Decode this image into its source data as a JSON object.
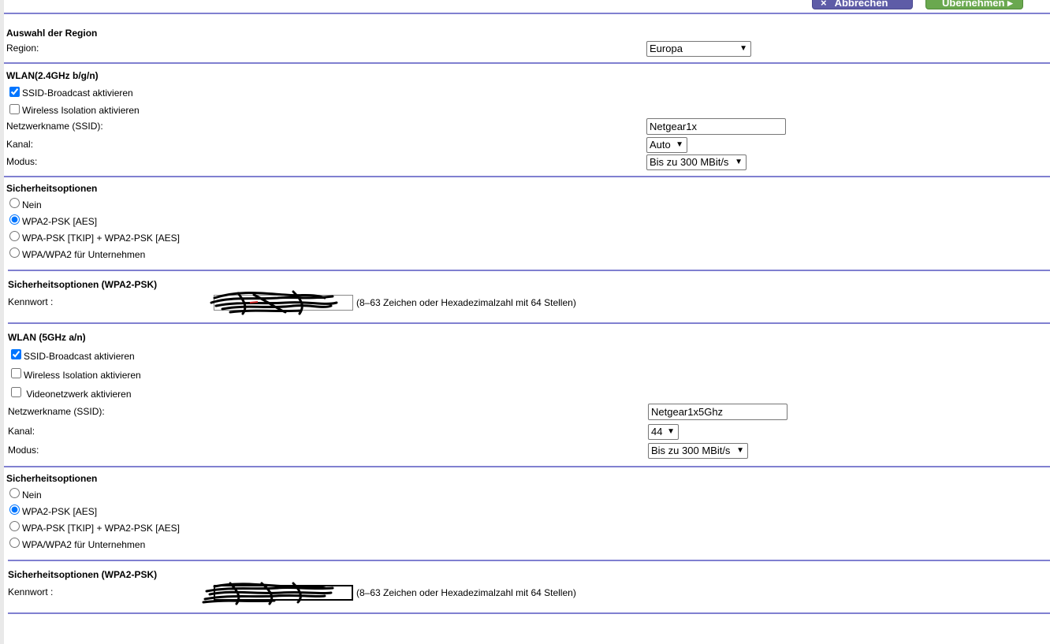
{
  "toolbar": {
    "cancel_label": "Abbrechen",
    "apply_label": "Übernehmen",
    "cancel_icon": "×",
    "apply_icon": "▸",
    "cancel_color": "#5e5ca7",
    "apply_color": "#6aa84f"
  },
  "region": {
    "heading": "Auswahl der Region",
    "label": "Region:",
    "value": "Europa"
  },
  "wlan24": {
    "heading": "WLAN(2.4GHz b/g/n)",
    "ssid_broadcast": {
      "label": "SSID-Broadcast aktivieren",
      "checked": true
    },
    "isolation": {
      "label": "Wireless Isolation aktivieren",
      "checked": false
    },
    "ssid_label": "Netzwerkname (SSID):",
    "ssid_value": "Netgear1x",
    "channel_label": "Kanal:",
    "channel_value": "Auto",
    "mode_label": "Modus:",
    "mode_value": "Bis zu 300 MBit/s"
  },
  "security24": {
    "heading": "Sicherheitsoptionen",
    "options": [
      "Nein",
      "WPA2-PSK [AES]",
      "WPA-PSK [TKIP] + WPA2-PSK [AES]",
      "WPA/WPA2 für Unternehmen"
    ],
    "selected": "WPA2-PSK [AES]"
  },
  "psk24": {
    "heading": "Sicherheitsoptionen (WPA2-PSK)",
    "password_label": "Kennwort :",
    "hint": "(8–63 Zeichen oder Hexadezimalzahl mit 64 Stellen)"
  },
  "wlan5": {
    "heading": "WLAN (5GHz a/n)",
    "ssid_broadcast": {
      "label": "SSID-Broadcast aktivieren",
      "checked": true
    },
    "isolation": {
      "label": "Wireless Isolation aktivieren",
      "checked": false
    },
    "video": {
      "label": " Videonetzwerk aktivieren",
      "checked": false
    },
    "ssid_label": "Netzwerkname (SSID):",
    "ssid_value": "Netgear1x5Ghz",
    "channel_label": "Kanal:",
    "channel_value": "44",
    "mode_label": "Modus:",
    "mode_value": "Bis zu 300 MBit/s"
  },
  "security5": {
    "heading": "Sicherheitsoptionen",
    "options": [
      "Nein",
      "WPA2-PSK [AES]",
      "WPA-PSK [TKIP] + WPA2-PSK [AES]",
      "WPA/WPA2 für Unternehmen"
    ],
    "selected": "WPA2-PSK [AES]"
  },
  "psk5": {
    "heading": "Sicherheitsoptionen (WPA2-PSK)",
    "password_label": "Kennwort :",
    "hint": "(8–63 Zeichen oder Hexadezimalzahl mit 64 Stellen)"
  }
}
